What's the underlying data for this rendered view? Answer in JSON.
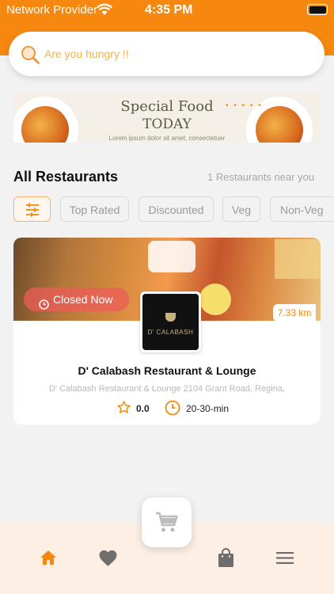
{
  "status_bar": {
    "carrier": "Network Provider",
    "time": "4:35 PM"
  },
  "search": {
    "placeholder": "Are you hungry !!",
    "icon": "search-icon"
  },
  "banner": {
    "title_line1": "Special Food",
    "title_line2": "TODAY",
    "tagline": "Lorem ipsum dolor sit amet, consectetuer"
  },
  "restaurants": {
    "title": "All Restaurants",
    "count_text": "1 Restaurants near you"
  },
  "filters": {
    "items": [
      "Top Rated",
      "Discounted",
      "Veg",
      "Non-Veg"
    ]
  },
  "restaurant_card": {
    "status": "Closed Now",
    "logo_text": "D' CALABASH",
    "distance": "7.33 km",
    "name": "D' Calabash Restaurant & Lounge",
    "address": "D' Calabash Restaurant & Lounge 2104 Grant Road, Regina,",
    "rating": "0.0",
    "delivery_time": "20-30-min"
  },
  "bottom_nav": {
    "items": [
      "home-icon",
      "heart-icon",
      "cart-icon",
      "bag-icon",
      "menu-icon"
    ]
  },
  "colors": {
    "brand": "#f6870f",
    "background": "#f2f2f2",
    "bottom_bar": "#fdefe3"
  }
}
